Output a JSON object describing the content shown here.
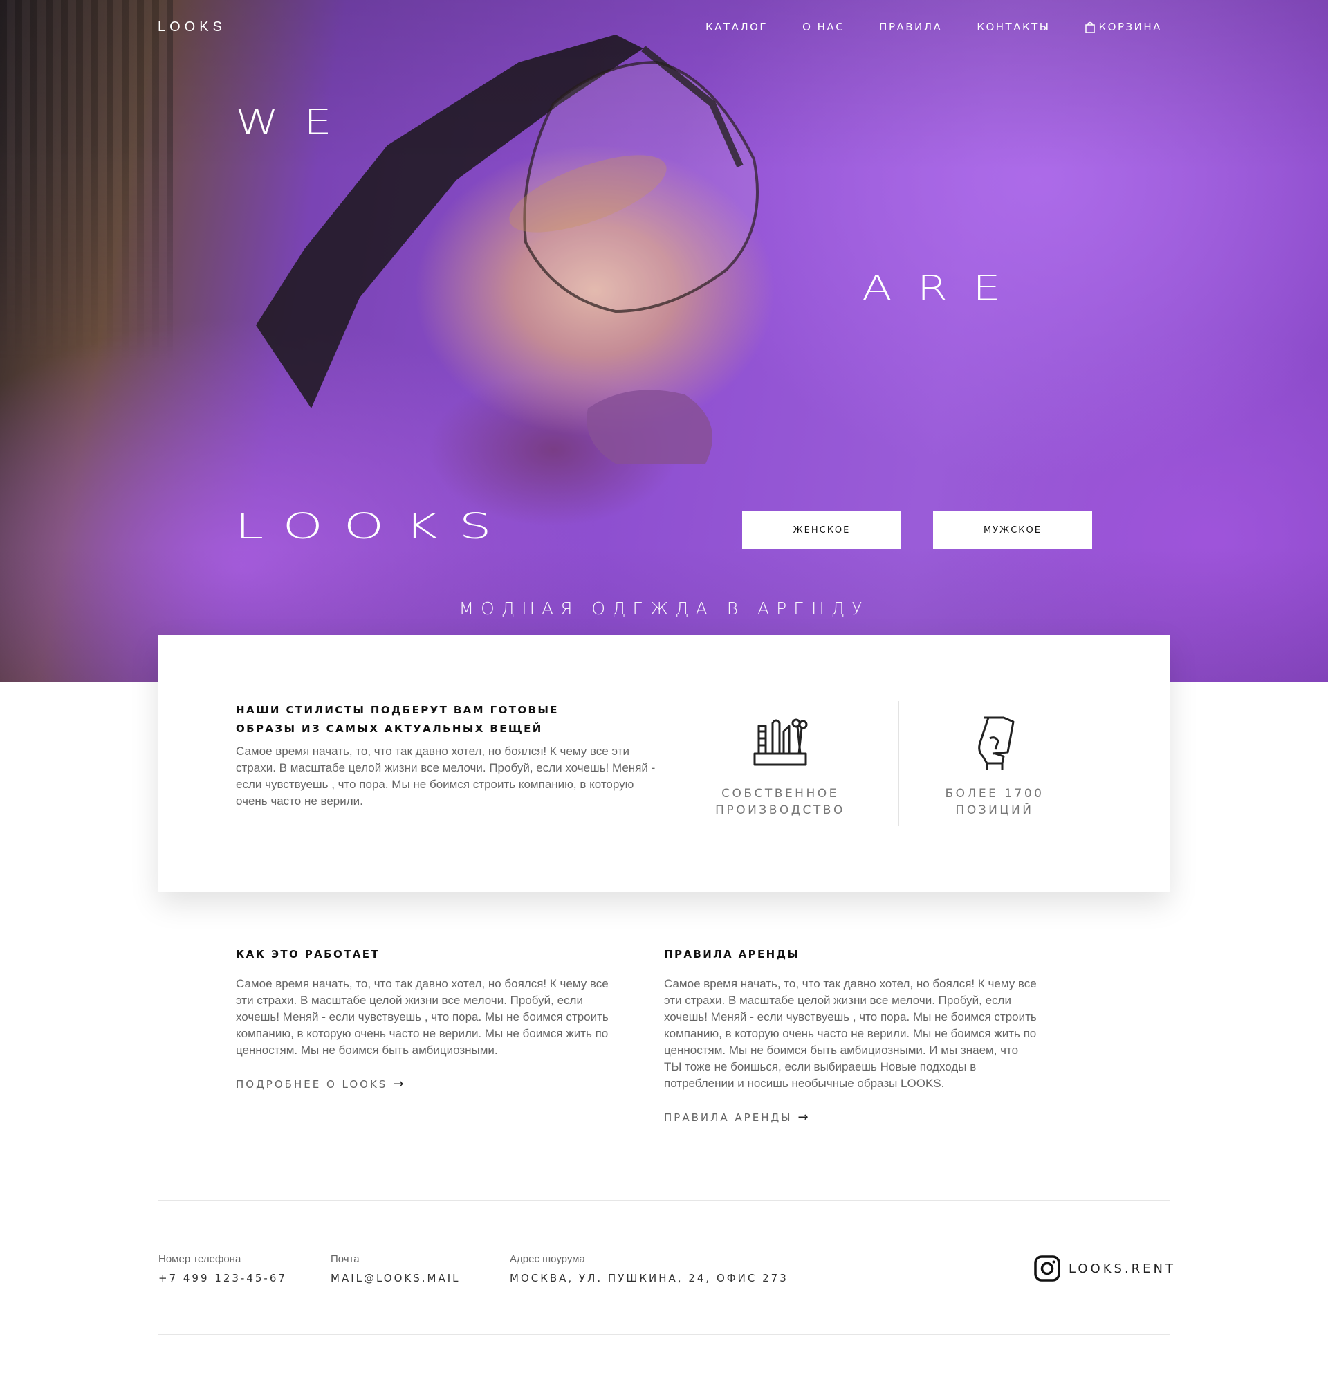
{
  "header": {
    "logo": "LOOKS",
    "nav": [
      {
        "label": "КАТАЛОГ"
      },
      {
        "label": "О НАС"
      },
      {
        "label": "ПРАВИЛА"
      },
      {
        "label": "КОНТАКТЫ"
      },
      {
        "label": "КОРЗИНА",
        "icon": "shopping-bag-icon"
      }
    ]
  },
  "hero": {
    "word1": "WE",
    "word2": "ARE",
    "word3": "LOOKS",
    "button_women": "ЖЕНСКОЕ",
    "button_men": "МУЖСКОЕ",
    "tagline": "МОДНАЯ ОДЕЖДА В АРЕНДУ",
    "accent_color": "#8e4fd0"
  },
  "card": {
    "title": "НАШИ СТИЛИСТЫ ПОДБЕРУТ ВАМ ГОТОВЫЕ ОБРАЗЫ ИЗ САМЫХ АКТУАЛЬНЫХ ВЕЩЕЙ",
    "text": "Самое время начать, то, что так давно хотел, но боялся! К чему все эти страхи. В масштабе целой жизни все мелочи. Пробуй, если хочешь! Меняй - если чувствуешь , что пора. Мы не боимся строить компанию, в которую очень часто не верили.",
    "features": [
      {
        "icon": "sewing-tools-icon",
        "label": "СОБСТВЕННОЕ ПРОИЗВОДСТВО"
      },
      {
        "icon": "hanger-hand-icon",
        "label": "БОЛЕЕ 1700 ПОЗИЦИЙ"
      }
    ]
  },
  "columns": [
    {
      "title": "КАК ЭТО РАБОТАЕТ",
      "text": "Самое время начать, то, что так давно хотел, но боялся! К чему все эти страхи. В масштабе целой жизни все мелочи. Пробуй, если хочешь! Меняй - если чувствуешь , что пора. Мы не боимся строить компанию, в которую очень часто не верили. Мы не боимся жить по ценностям. Мы не боимся быть амбициозными.",
      "link": "ПОДРОБНЕЕ О LOOKS"
    },
    {
      "title": "ПРАВИЛА АРЕНДЫ",
      "text": "Самое время начать, то, что так давно хотел, но боялся! К чему все эти страхи. В масштабе целой жизни все мелочи. Пробуй, если хочешь! Меняй - если чувствуешь , что пора. Мы не боимся строить компанию, в которую очень часто не верили. Мы не боимся жить по ценностям. Мы не боимся быть амбициозными. И мы знаем, что ТЫ тоже не боишься, если выбираешь Новые подходы в потреблении и носишь необычные образы LOOKS.",
      "link": "ПРАВИЛА АРЕНДЫ"
    }
  ],
  "footer": {
    "phone_label": "Номер телефона",
    "phone": "+7 499 123-45-67",
    "mail_label": "Почта",
    "mail": "MAIL@LOOKS.MAIL",
    "address_label": "Адрес шоурума",
    "address": "МОСКВА, УЛ. ПУШКИНА, 24, ОФИС 273",
    "instagram": "LOOKS.RENT"
  }
}
